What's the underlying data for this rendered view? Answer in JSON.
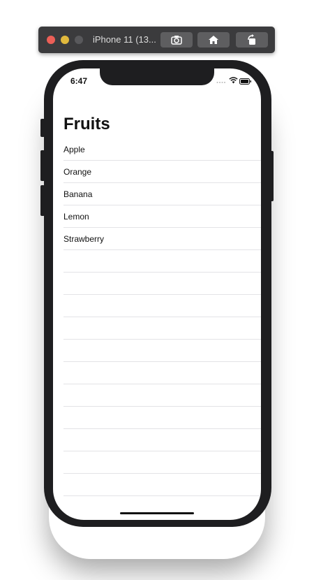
{
  "simulator": {
    "device_title": "iPhone 11 (13...",
    "buttons": {
      "screenshot_icon": "camera-icon",
      "home_icon": "home-icon",
      "rotate_icon": "rotate-icon"
    }
  },
  "status_bar": {
    "time": "6:47"
  },
  "nav": {
    "title": "Fruits"
  },
  "fruits": [
    "Apple",
    "Orange",
    "Banana",
    "Lemon",
    "Strawberry"
  ],
  "empty_rows": 11
}
